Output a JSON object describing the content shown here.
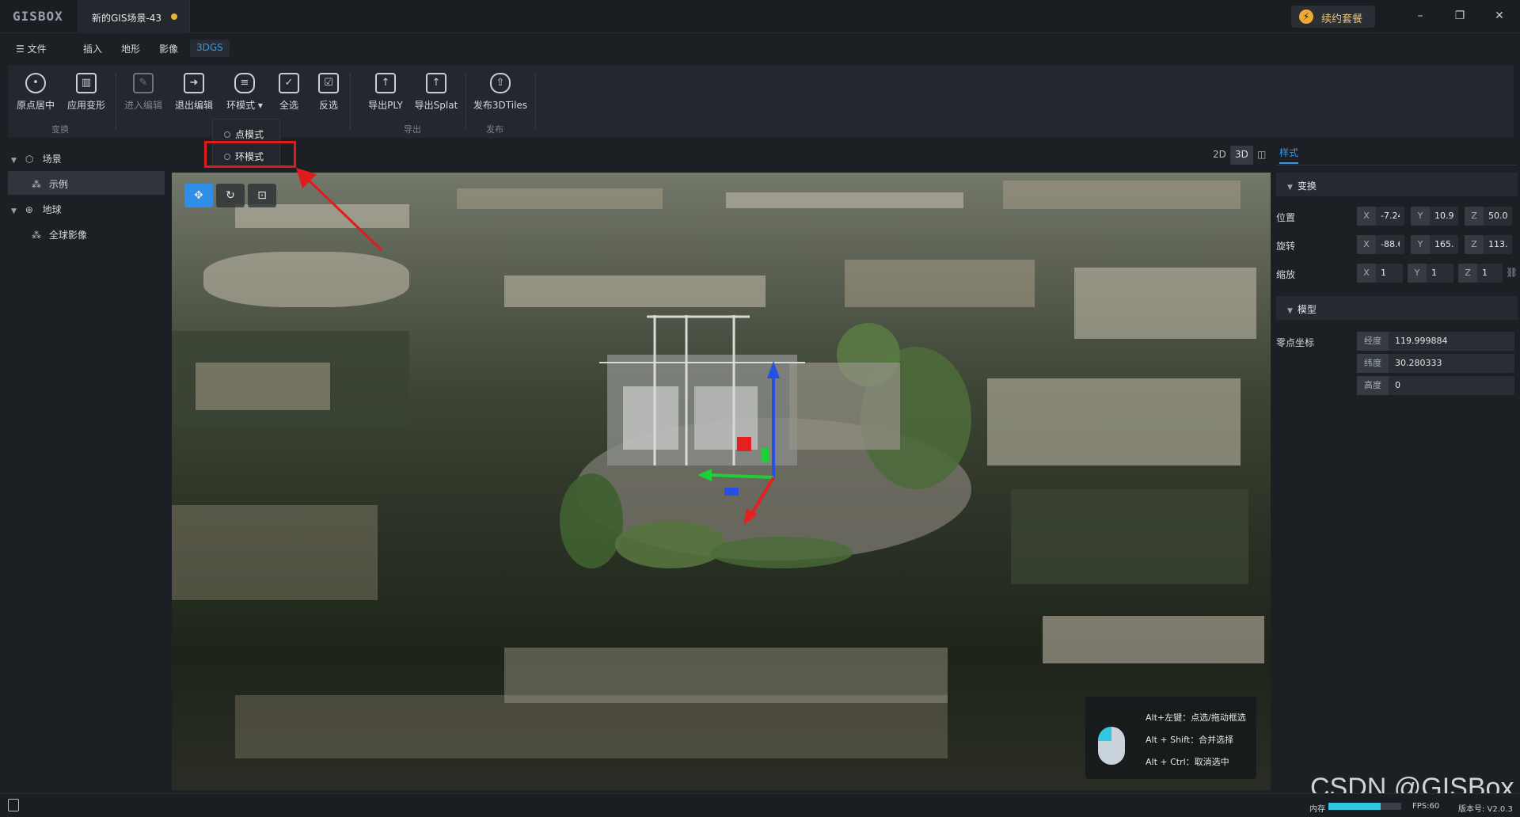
{
  "titlebar": {
    "logo": "GISBOX",
    "document_tab": "新的GIS场景-43",
    "renew_button": "续约套餐",
    "renew_icon": "lightning-icon",
    "window_buttons": {
      "minimize": "–",
      "maximize": "❐",
      "close": "✕"
    }
  },
  "menubar": {
    "file": "文件",
    "items": [
      "插入",
      "地形",
      "影像",
      "3DGS"
    ],
    "active": "3DGS"
  },
  "ribbon": {
    "tools": [
      {
        "label": "原点居中",
        "icon": "target-icon",
        "enabled": true
      },
      {
        "label": "应用变形",
        "icon": "map-icon",
        "enabled": true
      },
      {
        "label": "进入编辑",
        "icon": "edit-icon",
        "enabled": false
      },
      {
        "label": "退出编辑",
        "icon": "exit-icon",
        "enabled": true
      },
      {
        "label": "环模式",
        "icon": "layers-icon",
        "enabled": true
      },
      {
        "label": "全选",
        "icon": "checkbox-icon",
        "enabled": true
      },
      {
        "label": "反选",
        "icon": "invert-select-icon",
        "enabled": true
      },
      {
        "label": "导出PLY",
        "icon": "export-icon",
        "enabled": true
      },
      {
        "label": "导出Splat",
        "icon": "export-icon",
        "enabled": true
      },
      {
        "label": "发布3DTiles",
        "icon": "cloud-upload-icon",
        "enabled": true
      }
    ],
    "groups": {
      "transform": "变换",
      "export": "导出",
      "publish": "发布"
    }
  },
  "mode_dropdown": {
    "options": [
      "点模式",
      "环模式"
    ],
    "selected": "环模式"
  },
  "tree": {
    "scene": "场景",
    "example": "示例",
    "globe": "地球",
    "global_imagery": "全球影像"
  },
  "viewport": {
    "view_modes": [
      "2D",
      "3D",
      "◫"
    ],
    "active_view": "3D",
    "hints": [
      "Alt+左键：点选/拖动框选",
      "Alt + Shift：合并选择",
      "Alt + Ctrl：取消选中"
    ]
  },
  "props": {
    "tab": "样式",
    "transform_section": "变换",
    "position_label": "位置",
    "rotation_label": "旋转",
    "scale_label": "缩放",
    "position": {
      "x": "-7.24",
      "y": "10.9(",
      "z": "50.0("
    },
    "rotation": {
      "x": "-88.6",
      "y": "165.:",
      "z": "113.("
    },
    "scale": {
      "x": "1",
      "y": "1",
      "z": "1"
    },
    "model_section": "模型",
    "origin_label": "零点坐标",
    "longitude_label": "经度",
    "longitude": "119.999884",
    "latitude_label": "纬度",
    "latitude": "30.280333",
    "height_label": "高度",
    "height": "0"
  },
  "statusbar": {
    "memory_label": "内存",
    "memory_fraction": 0.72,
    "fps": "FPS:60",
    "version": "版本号: V2.0.3"
  },
  "watermark": "CSDN @GISBox",
  "colors": {
    "accent": "#2f9be8",
    "highlight": "#e01b1b",
    "memory": "#31c7e0"
  }
}
